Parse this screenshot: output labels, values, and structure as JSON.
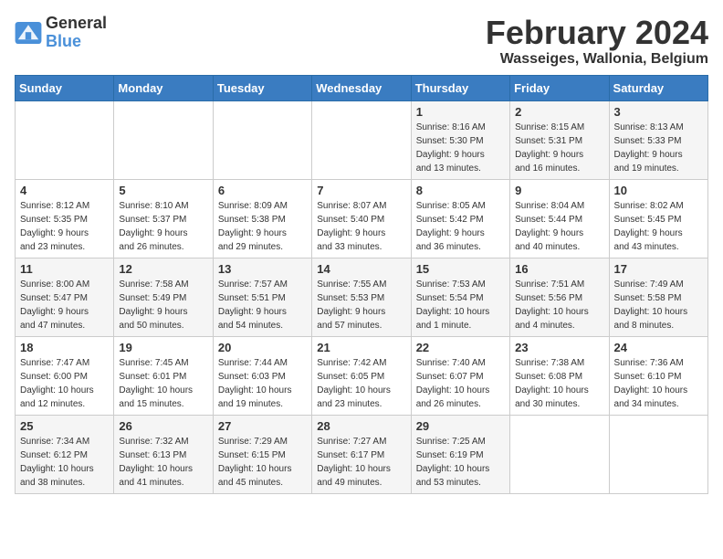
{
  "header": {
    "logo_line1": "General",
    "logo_line2": "Blue",
    "month_year": "February 2024",
    "location": "Wasseiges, Wallonia, Belgium"
  },
  "days_of_week": [
    "Sunday",
    "Monday",
    "Tuesday",
    "Wednesday",
    "Thursday",
    "Friday",
    "Saturday"
  ],
  "weeks": [
    [
      {
        "day": "",
        "info": ""
      },
      {
        "day": "",
        "info": ""
      },
      {
        "day": "",
        "info": ""
      },
      {
        "day": "",
        "info": ""
      },
      {
        "day": "1",
        "info": "Sunrise: 8:16 AM\nSunset: 5:30 PM\nDaylight: 9 hours\nand 13 minutes."
      },
      {
        "day": "2",
        "info": "Sunrise: 8:15 AM\nSunset: 5:31 PM\nDaylight: 9 hours\nand 16 minutes."
      },
      {
        "day": "3",
        "info": "Sunrise: 8:13 AM\nSunset: 5:33 PM\nDaylight: 9 hours\nand 19 minutes."
      }
    ],
    [
      {
        "day": "4",
        "info": "Sunrise: 8:12 AM\nSunset: 5:35 PM\nDaylight: 9 hours\nand 23 minutes."
      },
      {
        "day": "5",
        "info": "Sunrise: 8:10 AM\nSunset: 5:37 PM\nDaylight: 9 hours\nand 26 minutes."
      },
      {
        "day": "6",
        "info": "Sunrise: 8:09 AM\nSunset: 5:38 PM\nDaylight: 9 hours\nand 29 minutes."
      },
      {
        "day": "7",
        "info": "Sunrise: 8:07 AM\nSunset: 5:40 PM\nDaylight: 9 hours\nand 33 minutes."
      },
      {
        "day": "8",
        "info": "Sunrise: 8:05 AM\nSunset: 5:42 PM\nDaylight: 9 hours\nand 36 minutes."
      },
      {
        "day": "9",
        "info": "Sunrise: 8:04 AM\nSunset: 5:44 PM\nDaylight: 9 hours\nand 40 minutes."
      },
      {
        "day": "10",
        "info": "Sunrise: 8:02 AM\nSunset: 5:45 PM\nDaylight: 9 hours\nand 43 minutes."
      }
    ],
    [
      {
        "day": "11",
        "info": "Sunrise: 8:00 AM\nSunset: 5:47 PM\nDaylight: 9 hours\nand 47 minutes."
      },
      {
        "day": "12",
        "info": "Sunrise: 7:58 AM\nSunset: 5:49 PM\nDaylight: 9 hours\nand 50 minutes."
      },
      {
        "day": "13",
        "info": "Sunrise: 7:57 AM\nSunset: 5:51 PM\nDaylight: 9 hours\nand 54 minutes."
      },
      {
        "day": "14",
        "info": "Sunrise: 7:55 AM\nSunset: 5:53 PM\nDaylight: 9 hours\nand 57 minutes."
      },
      {
        "day": "15",
        "info": "Sunrise: 7:53 AM\nSunset: 5:54 PM\nDaylight: 10 hours\nand 1 minute."
      },
      {
        "day": "16",
        "info": "Sunrise: 7:51 AM\nSunset: 5:56 PM\nDaylight: 10 hours\nand 4 minutes."
      },
      {
        "day": "17",
        "info": "Sunrise: 7:49 AM\nSunset: 5:58 PM\nDaylight: 10 hours\nand 8 minutes."
      }
    ],
    [
      {
        "day": "18",
        "info": "Sunrise: 7:47 AM\nSunset: 6:00 PM\nDaylight: 10 hours\nand 12 minutes."
      },
      {
        "day": "19",
        "info": "Sunrise: 7:45 AM\nSunset: 6:01 PM\nDaylight: 10 hours\nand 15 minutes."
      },
      {
        "day": "20",
        "info": "Sunrise: 7:44 AM\nSunset: 6:03 PM\nDaylight: 10 hours\nand 19 minutes."
      },
      {
        "day": "21",
        "info": "Sunrise: 7:42 AM\nSunset: 6:05 PM\nDaylight: 10 hours\nand 23 minutes."
      },
      {
        "day": "22",
        "info": "Sunrise: 7:40 AM\nSunset: 6:07 PM\nDaylight: 10 hours\nand 26 minutes."
      },
      {
        "day": "23",
        "info": "Sunrise: 7:38 AM\nSunset: 6:08 PM\nDaylight: 10 hours\nand 30 minutes."
      },
      {
        "day": "24",
        "info": "Sunrise: 7:36 AM\nSunset: 6:10 PM\nDaylight: 10 hours\nand 34 minutes."
      }
    ],
    [
      {
        "day": "25",
        "info": "Sunrise: 7:34 AM\nSunset: 6:12 PM\nDaylight: 10 hours\nand 38 minutes."
      },
      {
        "day": "26",
        "info": "Sunrise: 7:32 AM\nSunset: 6:13 PM\nDaylight: 10 hours\nand 41 minutes."
      },
      {
        "day": "27",
        "info": "Sunrise: 7:29 AM\nSunset: 6:15 PM\nDaylight: 10 hours\nand 45 minutes."
      },
      {
        "day": "28",
        "info": "Sunrise: 7:27 AM\nSunset: 6:17 PM\nDaylight: 10 hours\nand 49 minutes."
      },
      {
        "day": "29",
        "info": "Sunrise: 7:25 AM\nSunset: 6:19 PM\nDaylight: 10 hours\nand 53 minutes."
      },
      {
        "day": "",
        "info": ""
      },
      {
        "day": "",
        "info": ""
      }
    ]
  ]
}
